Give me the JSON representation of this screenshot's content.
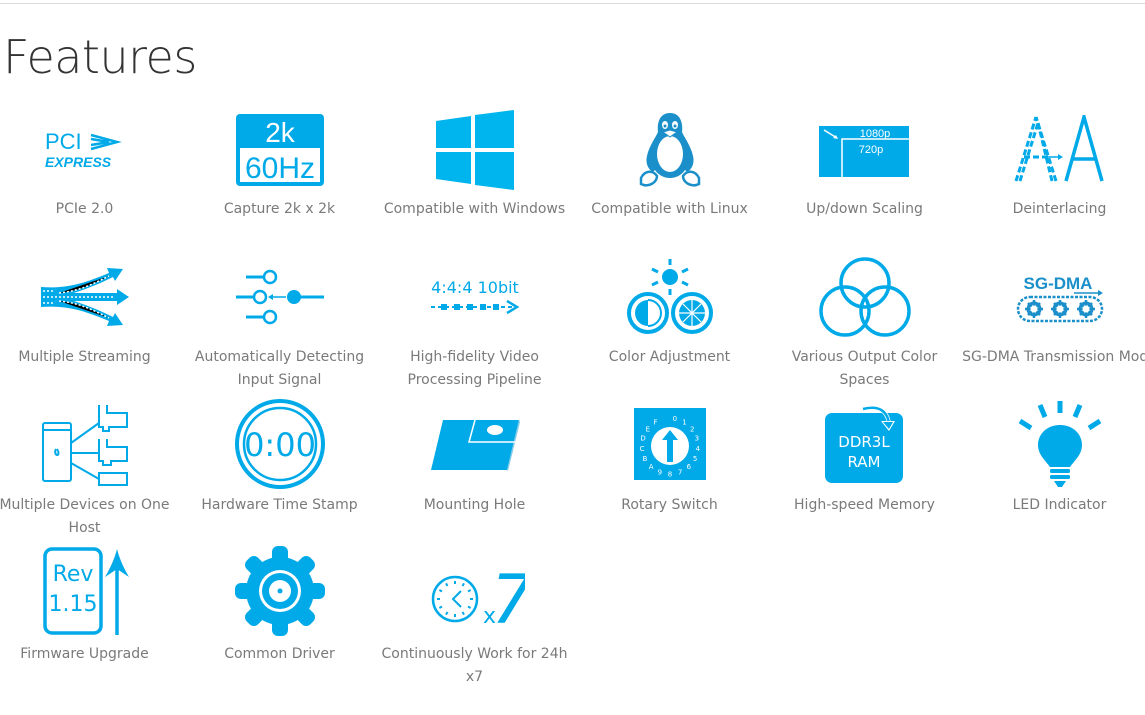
{
  "page": {
    "title": "Features"
  },
  "accent_color": "#00a9e8",
  "features": [
    {
      "icon": "pcie-icon",
      "label": "PCIe 2.0",
      "icon_text": [
        "PCI",
        "EXPRESS"
      ]
    },
    {
      "icon": "capture-2k-icon",
      "label": "Capture 2k x 2k",
      "icon_text": [
        "2k",
        "60Hz"
      ]
    },
    {
      "icon": "windows-icon",
      "label": "Compatible with Windows"
    },
    {
      "icon": "linux-icon",
      "label": "Compatible with Linux"
    },
    {
      "icon": "scaling-icon",
      "label": "Up/down Scaling",
      "icon_text": [
        "1080p",
        "720p"
      ]
    },
    {
      "icon": "deinterlacing-icon",
      "label": "Deinterlacing",
      "icon_text": [
        "A",
        "A"
      ]
    },
    {
      "icon": "multiple-streaming-icon",
      "label": "Multiple Streaming"
    },
    {
      "icon": "input-signal-icon",
      "label": "Automatically Detecting Input Signal"
    },
    {
      "icon": "pipeline-icon",
      "label": "High-fidelity Video Processing Pipeline",
      "icon_text": [
        "4:4:4 10bit"
      ]
    },
    {
      "icon": "color-adjustment-icon",
      "label": "Color Adjustment"
    },
    {
      "icon": "color-spaces-icon",
      "label": "Various Output Color Spaces"
    },
    {
      "icon": "sg-dma-icon",
      "label": "SG-DMA Transmission Mode",
      "icon_text": [
        "SG-DMA"
      ]
    },
    {
      "icon": "multiple-devices-icon",
      "label": "Multiple Devices on One Host"
    },
    {
      "icon": "time-stamp-icon",
      "label": "Hardware Time Stamp",
      "icon_text": [
        "0:00"
      ]
    },
    {
      "icon": "mounting-hole-icon",
      "label": "Mounting Hole"
    },
    {
      "icon": "rotary-switch-icon",
      "label": "Rotary Switch",
      "icon_text": [
        "0",
        "1",
        "2",
        "3",
        "4",
        "5",
        "6",
        "7",
        "8",
        "9",
        "A",
        "B",
        "C",
        "D",
        "E",
        "F"
      ]
    },
    {
      "icon": "memory-icon",
      "label": "High-speed Memory",
      "icon_text": [
        "DDR3L",
        "RAM"
      ]
    },
    {
      "icon": "led-indicator-icon",
      "label": "LED Indicator"
    },
    {
      "icon": "firmware-upgrade-icon",
      "label": "Firmware Upgrade",
      "icon_text": [
        "Rev",
        "1.15"
      ]
    },
    {
      "icon": "common-driver-icon",
      "label": "Common Driver"
    },
    {
      "icon": "continuous-work-icon",
      "label": "Continuously Work for 24h x7",
      "icon_text": [
        "x",
        "7"
      ]
    }
  ]
}
